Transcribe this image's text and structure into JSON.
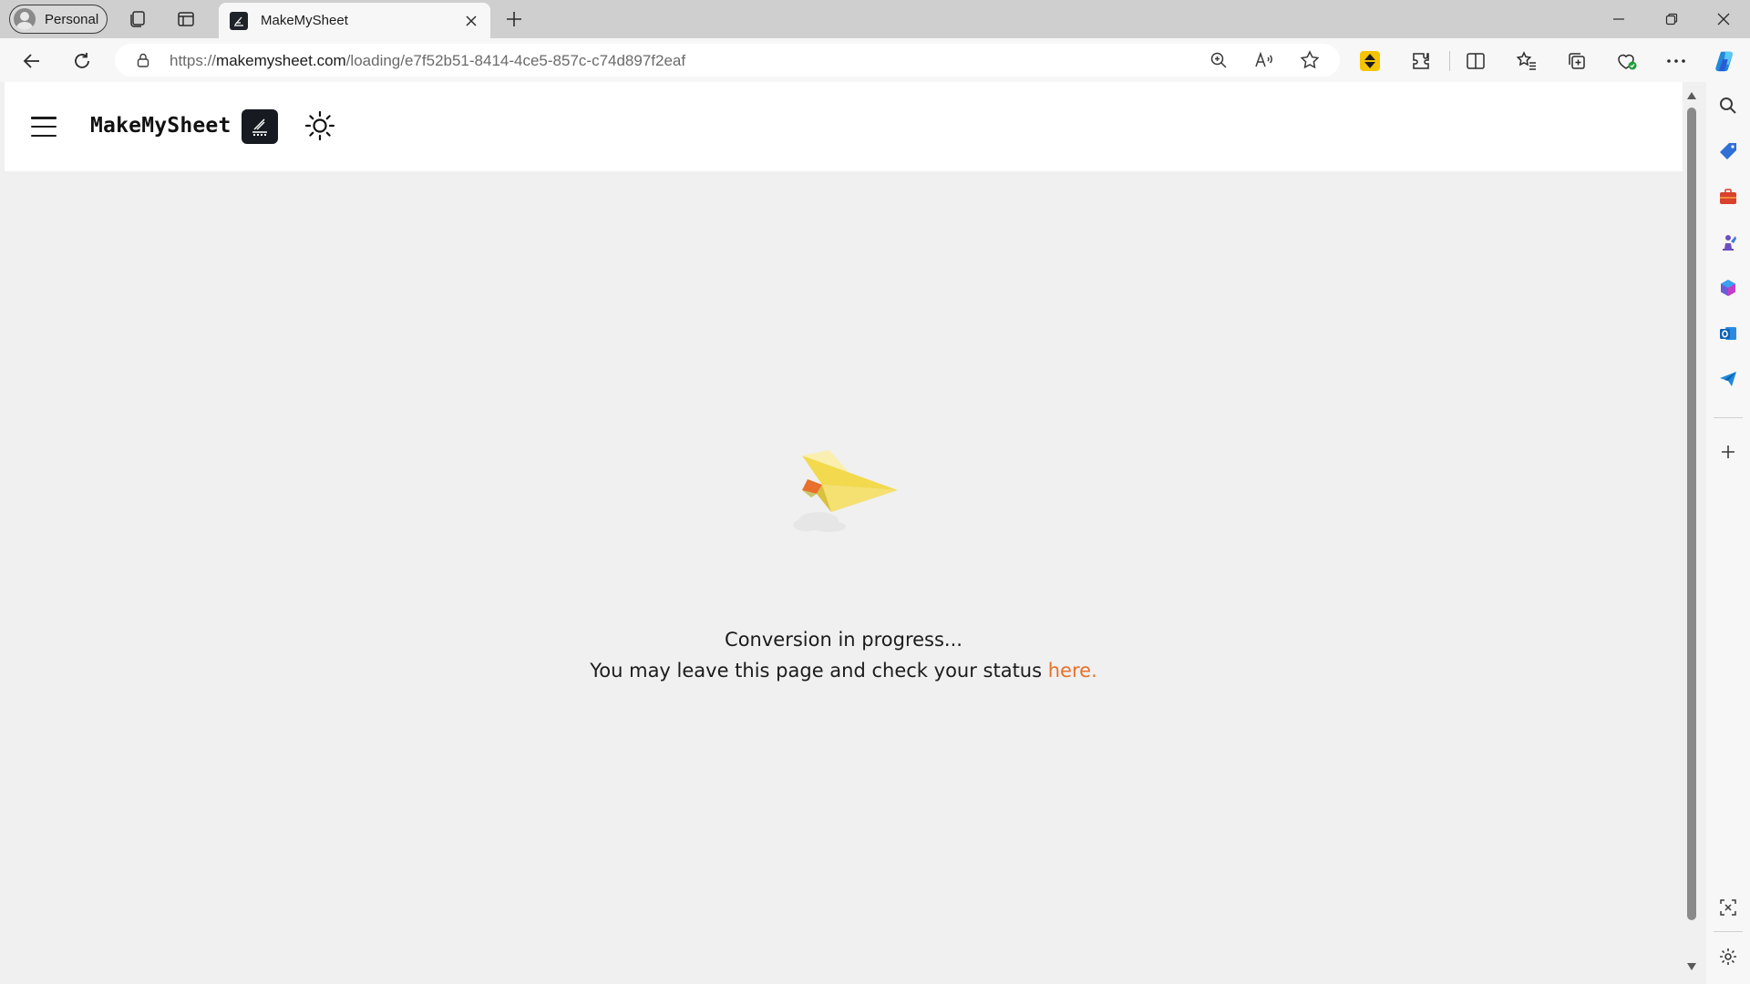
{
  "browser": {
    "profile_label": "Personal",
    "tab_title": "MakeMySheet",
    "url_prefix": "https://",
    "url_host": "makemysheet.com",
    "url_path": "/loading/e7f52b51-8414-4ce5-857c-c74d897f2eaf"
  },
  "header": {
    "brand": "MakeMySheet"
  },
  "status": {
    "line1": "Conversion in progress...",
    "line2_prefix": "You may leave this page and check your status ",
    "link_text": "here."
  },
  "colors": {
    "accent_link": "#e8702a",
    "plane": "#f2d94e",
    "plane_accent": "#e8702a"
  }
}
